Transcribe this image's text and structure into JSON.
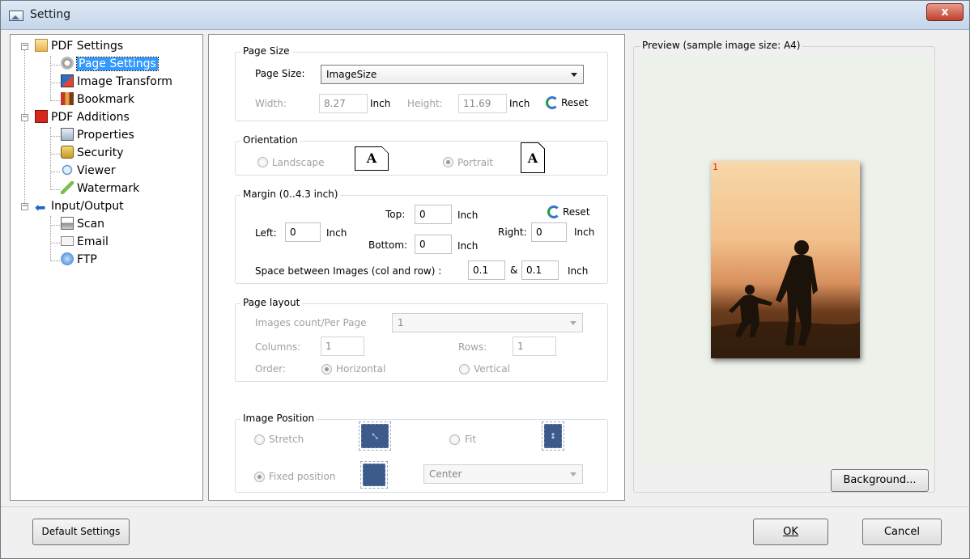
{
  "window": {
    "title": "Setting",
    "close_label": "x"
  },
  "tree": {
    "pdf_settings": "PDF Settings",
    "page_settings": "Page Settings",
    "image_transform": "Image Transform",
    "bookmark": "Bookmark",
    "pdf_additions": "PDF Additions",
    "properties": "Properties",
    "security": "Security",
    "viewer": "Viewer",
    "watermark": "Watermark",
    "input_output": "Input/Output",
    "scan": "Scan",
    "email": "Email",
    "ftp": "FTP"
  },
  "page_size": {
    "group_title": "Page Size",
    "label": "Page Size:",
    "selected": "ImageSize",
    "width_label": "Width:",
    "width_value": "8.27",
    "width_unit": "Inch",
    "height_label": "Height:",
    "height_value": "11.69",
    "height_unit": "Inch",
    "reset_label": "Reset"
  },
  "orientation": {
    "group_title": "Orientation",
    "landscape": "Landscape",
    "portrait": "Portrait",
    "glyph": "A",
    "selected": "Portrait"
  },
  "margin": {
    "group_title": "Margin (0..4.3 inch)",
    "top_label": "Top:",
    "top_value": "0",
    "left_label": "Left:",
    "left_value": "0",
    "bottom_label": "Bottom:",
    "bottom_value": "0",
    "right_label": "Right:",
    "right_value": "0",
    "unit": "Inch",
    "reset_label": "Reset",
    "space_label": "Space between Images (col and row) :",
    "space_col": "0.1",
    "amp": "&",
    "space_row": "0.1"
  },
  "page_layout": {
    "group_title": "Page layout",
    "count_label": "Images count/Per Page",
    "count_value": "1",
    "columns_label": "Columns:",
    "columns_value": "1",
    "rows_label": "Rows:",
    "rows_value": "1",
    "order_label": "Order:",
    "horizontal": "Horizontal",
    "vertical": "Vertical",
    "selected": "Horizontal"
  },
  "image_position": {
    "group_title": "Image Position",
    "stretch": "Stretch",
    "fit": "Fit",
    "fixed": "Fixed position",
    "fixed_value": "Center",
    "selected": "Fixed position"
  },
  "preview": {
    "title": "Preview (sample image size: A4)",
    "page_number": "1",
    "background_button": "Background..."
  },
  "footer": {
    "default_settings": "Default Settings",
    "ok": "OK",
    "cancel": "Cancel"
  }
}
